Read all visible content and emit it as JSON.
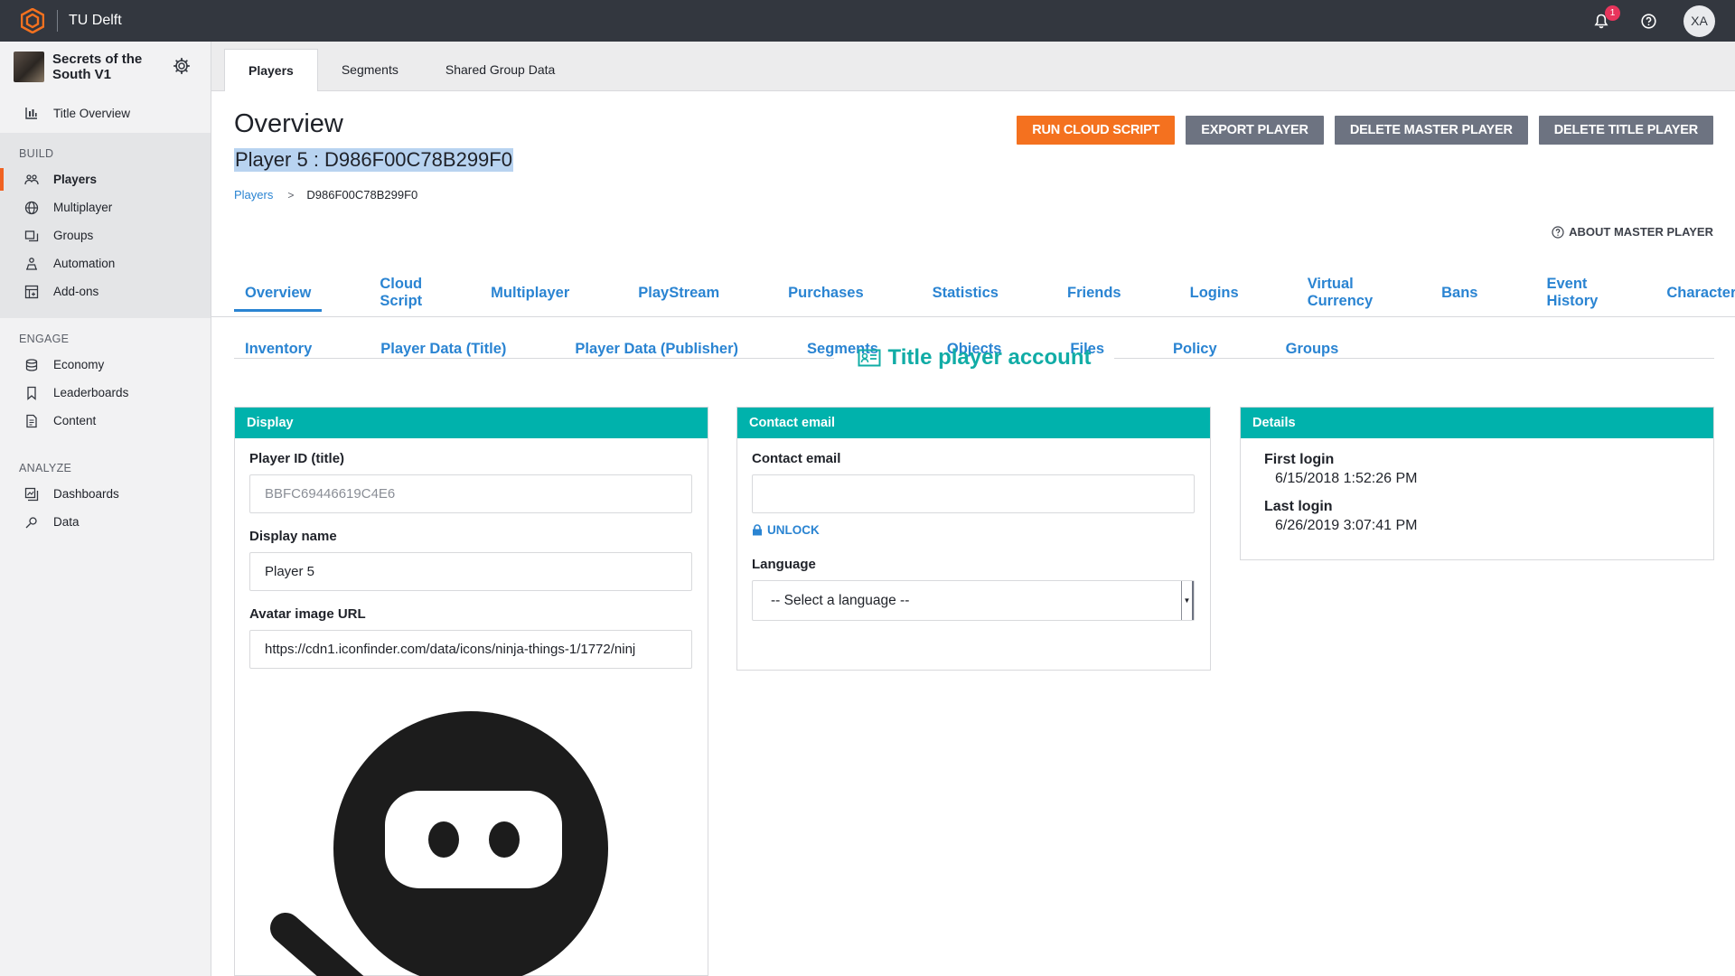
{
  "topbar": {
    "org_name": "TU Delft",
    "notification_count": "1",
    "user_initials": "XA"
  },
  "sidebar": {
    "title_name": "Secrets of the South V1",
    "overview_label": "Title Overview",
    "sections": [
      {
        "label": "BUILD",
        "items": [
          "Players",
          "Multiplayer",
          "Groups",
          "Automation",
          "Add-ons"
        ]
      },
      {
        "label": "ENGAGE",
        "items": [
          "Economy",
          "Leaderboards",
          "Content"
        ]
      },
      {
        "label": "ANALYZE",
        "items": [
          "Dashboards",
          "Data"
        ]
      }
    ],
    "active_item": "Players"
  },
  "top_tabs": [
    "Players",
    "Segments",
    "Shared Group Data"
  ],
  "header": {
    "title": "Overview",
    "player_heading": "Player 5 : D986F00C78B299F0",
    "breadcrumb_root": "Players",
    "breadcrumb_current": "D986F00C78B299F0",
    "actions": {
      "run_cloud_script": "RUN CLOUD SCRIPT",
      "export_player": "EXPORT PLAYER",
      "delete_master_player": "DELETE MASTER PLAYER",
      "delete_title_player": "DELETE TITLE PLAYER"
    },
    "about_link": "ABOUT MASTER PLAYER"
  },
  "subtabs": {
    "row1": [
      "Overview",
      "Cloud Script",
      "Multiplayer",
      "PlayStream",
      "Purchases",
      "Statistics",
      "Friends",
      "Logins",
      "Virtual Currency",
      "Bans",
      "Event History",
      "Characters"
    ],
    "row2": [
      "Inventory",
      "Player Data (Title)",
      "Player Data (Publisher)",
      "Segments",
      "Objects",
      "Files",
      "Policy",
      "Groups"
    ],
    "active": "Overview"
  },
  "section_title": "Title player account",
  "display_card": {
    "header": "Display",
    "player_id_label": "Player ID (title)",
    "player_id_value": "BBFC69446619C4E6",
    "display_name_label": "Display name",
    "display_name_value": "Player 5",
    "avatar_url_label": "Avatar image URL",
    "avatar_url_value": "https://cdn1.iconfinder.com/data/icons/ninja-things-1/1772/ninj"
  },
  "contact_card": {
    "header": "Contact email",
    "email_label": "Contact email",
    "email_value": "",
    "unlock_label": "UNLOCK",
    "language_label": "Language",
    "language_value": "-- Select a language --"
  },
  "details_card": {
    "header": "Details",
    "first_login_label": "First login",
    "first_login_value": "6/15/2018 1:52:26 PM",
    "last_login_label": "Last login",
    "last_login_value": "6/26/2019 3:07:41 PM"
  },
  "colors": {
    "topbar": "#33373f",
    "accent_orange": "#f4711f",
    "link_blue": "#2a84d2",
    "teal": "#00b2ac",
    "grey_button": "#6d7381"
  }
}
